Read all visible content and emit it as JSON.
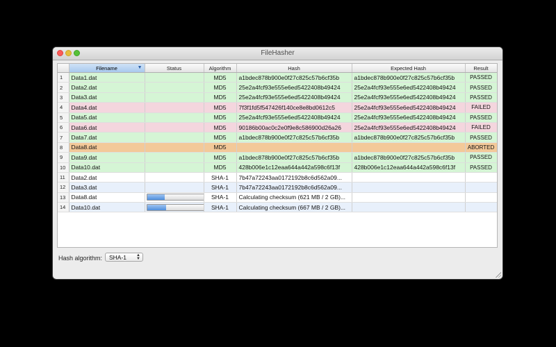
{
  "window": {
    "title": "FileHasher"
  },
  "table": {
    "columns": [
      "Filename",
      "Status",
      "Algorithm",
      "Hash",
      "Expected Hash",
      "Result"
    ],
    "sorted_column": "Filename",
    "rows": [
      {
        "num": "1",
        "filename": "Data1.dat",
        "status": "",
        "progress": null,
        "algorithm": "MD5",
        "hash": "a1bdec878b900e0f27c825c57b6cf35b",
        "expected": "a1bdec878b900e0f27c825c57b6cf35b",
        "result": "PASSED",
        "state": "passed"
      },
      {
        "num": "2",
        "filename": "Data2.dat",
        "status": "",
        "progress": null,
        "algorithm": "MD5",
        "hash": "25e2a4fcf93e555e6ed5422408b49424",
        "expected": "25e2a4fcf93e555e6ed5422408b49424",
        "result": "PASSED",
        "state": "passed"
      },
      {
        "num": "3",
        "filename": "Data3.dat",
        "status": "",
        "progress": null,
        "algorithm": "MD5",
        "hash": "25e2a4fcf93e555e6ed5422408b49424",
        "expected": "25e2a4fcf93e555e6ed5422408b49424",
        "result": "PASSED",
        "state": "passed"
      },
      {
        "num": "4",
        "filename": "Data4.dat",
        "status": "",
        "progress": null,
        "algorithm": "MD5",
        "hash": "7f3f1fd5f547426f140ce8e8bd0612c5",
        "expected": "25e2a4fcf93e555e6ed5422408b49424",
        "result": "FAILED",
        "state": "failed"
      },
      {
        "num": "5",
        "filename": "Data5.dat",
        "status": "",
        "progress": null,
        "algorithm": "MD5",
        "hash": "25e2a4fcf93e555e6ed5422408b49424",
        "expected": "25e2a4fcf93e555e6ed5422408b49424",
        "result": "PASSED",
        "state": "passed"
      },
      {
        "num": "6",
        "filename": "Data6.dat",
        "status": "",
        "progress": null,
        "algorithm": "MD5",
        "hash": "90186b00ac0c2e0f9e8c586900d26a26",
        "expected": "25e2a4fcf93e555e6ed5422408b49424",
        "result": "FAILED",
        "state": "failed"
      },
      {
        "num": "7",
        "filename": "Data7.dat",
        "status": "",
        "progress": null,
        "algorithm": "MD5",
        "hash": "a1bdec878b900e0f27c825c57b6cf35b",
        "expected": "a1bdec878b900e0f27c825c57b6cf35b",
        "result": "PASSED",
        "state": "passed"
      },
      {
        "num": "8",
        "filename": "Data8.dat",
        "status": "",
        "progress": null,
        "algorithm": "MD5",
        "hash": "",
        "expected": "",
        "result": "ABORTED",
        "state": "aborted"
      },
      {
        "num": "9",
        "filename": "Data9.dat",
        "status": "",
        "progress": null,
        "algorithm": "MD5",
        "hash": "a1bdec878b900e0f27c825c57b6cf35b",
        "expected": "a1bdec878b900e0f27c825c57b6cf35b",
        "result": "PASSED",
        "state": "passed"
      },
      {
        "num": "10",
        "filename": "Data10.dat",
        "status": "",
        "progress": null,
        "algorithm": "MD5",
        "hash": "428b006e1c12eaa644a442a598c6f13f",
        "expected": "428b006e1c12eaa644a442a598c6f13f",
        "result": "PASSED",
        "state": "passed"
      },
      {
        "num": "11",
        "filename": "Data2.dat",
        "status": "",
        "progress": null,
        "algorithm": "SHA-1",
        "hash": "7b47a72243aa0172192b8c6d562a09...",
        "expected": "",
        "result": "",
        "state": "pend-white"
      },
      {
        "num": "12",
        "filename": "Data3.dat",
        "status": "",
        "progress": null,
        "algorithm": "SHA-1",
        "hash": "7b47a72243aa0172192b8c6d562a09...",
        "expected": "",
        "result": "",
        "state": "pend-blue"
      },
      {
        "num": "13",
        "filename": "Data8.dat",
        "status": "",
        "progress": 0.31,
        "algorithm": "SHA-1",
        "hash": "Calculating checksum (621 MB / 2 GB)...",
        "expected": "",
        "result": "",
        "state": "pend-white"
      },
      {
        "num": "14",
        "filename": "Data10.dat",
        "status": "",
        "progress": 0.33,
        "algorithm": "SHA-1",
        "hash": "Calculating checksum (667 MB / 2 GB)...",
        "expected": "",
        "result": "",
        "state": "pend-blue"
      }
    ]
  },
  "footer": {
    "hash_algorithm_label": "Hash algorithm:",
    "hash_algorithm_value": "SHA-1"
  },
  "colors": {
    "passed": "#d5f5d5",
    "failed": "#f4d6de",
    "aborted": "#f3c999",
    "progress": "#4f8fdd"
  }
}
